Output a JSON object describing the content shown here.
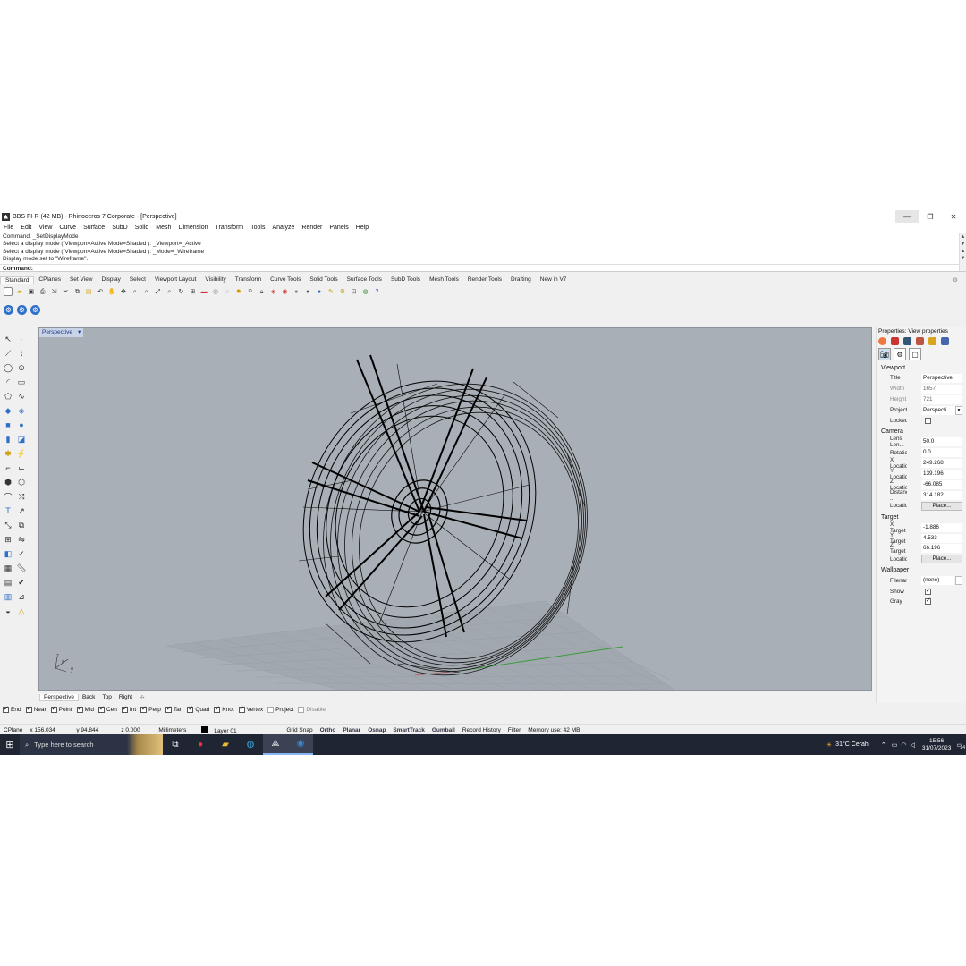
{
  "window": {
    "title": "BBS FI-R (42 MB) - Rhinoceros 7 Corporate - [Perspective]",
    "min_glyph": "—",
    "max_glyph": "❐",
    "close_glyph": "✕"
  },
  "menu": [
    "File",
    "Edit",
    "View",
    "Curve",
    "Surface",
    "SubD",
    "Solid",
    "Mesh",
    "Dimension",
    "Transform",
    "Tools",
    "Analyze",
    "Render",
    "Panels",
    "Help"
  ],
  "command": {
    "history": [
      "Command: _SetDisplayMode",
      "Select a display mode ( Viewport=Active  Mode=Shaded ): _Viewport=_Active",
      "Select a display mode ( Viewport=Active  Mode=Shaded ): _Mode=_Wireframe",
      "Display mode set to \"Wireframe\"."
    ],
    "prompt": "Command:"
  },
  "toolbar_tabs": [
    "Standard",
    "CPlanes",
    "Set View",
    "Display",
    "Select",
    "Viewport Layout",
    "Visibility",
    "Transform",
    "Curve Tools",
    "Solid Tools",
    "Surface Tools",
    "SubD Tools",
    "Mesh Tools",
    "Render Tools",
    "Drafting",
    "New in V7"
  ],
  "active_tab": "Standard",
  "viewport": {
    "name": "Perspective",
    "tabs": [
      "Perspective",
      "Back",
      "Top",
      "Right"
    ],
    "add_tab_glyph": "✣",
    "axes_labels": {
      "x": "x",
      "y": "y",
      "z": "z"
    }
  },
  "osnap": [
    {
      "label": "End",
      "checked": true
    },
    {
      "label": "Near",
      "checked": true
    },
    {
      "label": "Point",
      "checked": true
    },
    {
      "label": "Mid",
      "checked": true
    },
    {
      "label": "Cen",
      "checked": true
    },
    {
      "label": "Int",
      "checked": true
    },
    {
      "label": "Perp",
      "checked": true
    },
    {
      "label": "Tan",
      "checked": true
    },
    {
      "label": "Quad",
      "checked": true
    },
    {
      "label": "Knot",
      "checked": true
    },
    {
      "label": "Vertex",
      "checked": true
    },
    {
      "label": "Project",
      "checked": false
    },
    {
      "label": "Disable",
      "checked": false
    }
  ],
  "status": {
    "cplane": "CPlane",
    "x": "x 156.034",
    "y": "y 94.844",
    "z": "z 0.000",
    "units": "Millimeters",
    "layer": "Layer 01",
    "toggles": [
      "Grid Snap",
      "Ortho",
      "Planar",
      "Osnap",
      "SmartTrack",
      "Gumball",
      "Record History",
      "Filter"
    ],
    "bold_toggles": [
      "Ortho",
      "Planar",
      "Osnap",
      "SmartTrack",
      "Gumball"
    ],
    "memory": "Memory use: 42 MB"
  },
  "properties": {
    "title": "Properties: View properties",
    "viewport_section": "Viewport",
    "viewport": [
      {
        "key": "Title",
        "value": "Perspective",
        "grey": false
      },
      {
        "key": "Width",
        "value": "1657",
        "grey": true
      },
      {
        "key": "Height",
        "value": "721",
        "grey": true
      },
      {
        "key": "Projection",
        "value": "Perspecti...",
        "grey": false
      }
    ],
    "locked_label": "Locked",
    "camera_section": "Camera",
    "camera": [
      {
        "key": "Lens Len...",
        "value": "50.0"
      },
      {
        "key": "Rotation",
        "value": "0.0"
      },
      {
        "key": "X Location",
        "value": "249.268"
      },
      {
        "key": "Y Location",
        "value": "139.196"
      },
      {
        "key": "Z Location",
        "value": "-66.085"
      },
      {
        "key": "Distance ...",
        "value": "314.182"
      }
    ],
    "location_label": "Location",
    "place_button": "Place...",
    "target_section": "Target",
    "target": [
      {
        "key": "X Target",
        "value": "-1.886"
      },
      {
        "key": "Y Target",
        "value": "4.533"
      },
      {
        "key": "Z Target",
        "value": "66.196"
      }
    ],
    "wallpaper_section": "Wallpaper",
    "filename_label": "Filename",
    "filename_value": "(none)",
    "show_label": "Show",
    "gray_label": "Gray",
    "dots": "..."
  },
  "taskbar": {
    "search_placeholder": "Type here to search",
    "weather": "31°C  Cerah",
    "time": "15:56",
    "date": "31/07/2023",
    "notifications": "24"
  },
  "colors": {
    "viewport_bg": "#a9afb6",
    "accent_blue": "#2f6fc9",
    "taskbar": "#1f2533"
  }
}
